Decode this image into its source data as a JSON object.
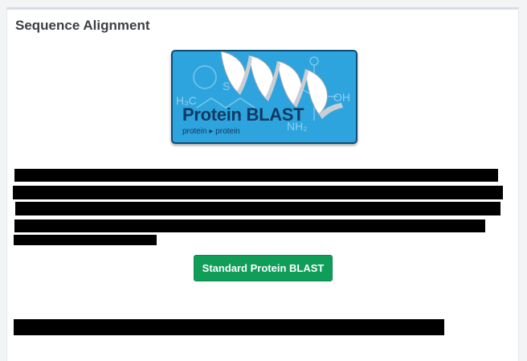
{
  "panel": {
    "title": "Sequence Alignment"
  },
  "banner": {
    "title": "Protein BLAST",
    "subtitle_from": "protein",
    "subtitle_arrow": "▸",
    "subtitle_to": "protein"
  },
  "actions": {
    "primary_label": "Standard Protein BLAST"
  },
  "colors": {
    "banner_blue": "#2da4dd",
    "banner_text": "#103a63",
    "button_green": "#0f9d58"
  }
}
